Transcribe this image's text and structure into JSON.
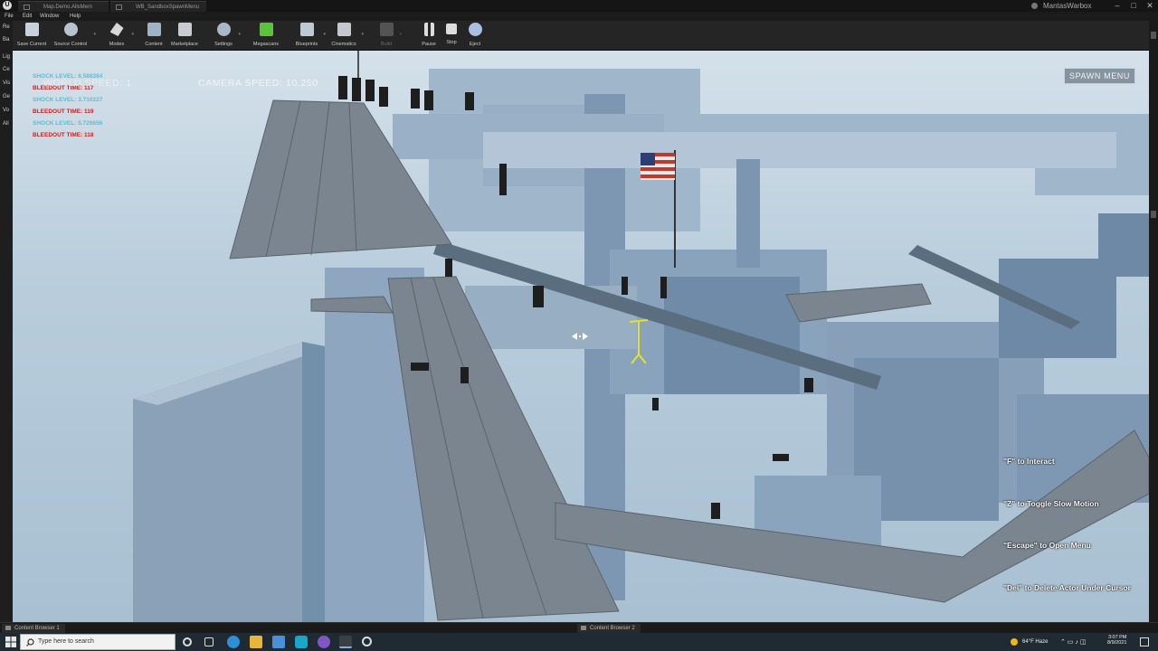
{
  "titlebar": {
    "tabs": [
      "Map.Demo.AllsMem",
      "WB_SandboxSpawnMenu"
    ],
    "user": "MantasWarbox",
    "window_controls": [
      "minimize",
      "maximize",
      "close"
    ]
  },
  "menu": [
    "File",
    "Edit",
    "Window",
    "Help"
  ],
  "toolbar": {
    "buttons": [
      {
        "label": "Save Current",
        "icon": "save-icon"
      },
      {
        "label": "Source Control",
        "icon": "source-control-icon"
      },
      {
        "label": "Modes",
        "icon": "modes-icon"
      },
      {
        "label": "Content",
        "icon": "content-icon"
      },
      {
        "label": "Marketplace",
        "icon": "marketplace-icon"
      },
      {
        "label": "Settings",
        "icon": "settings-icon"
      },
      {
        "label": "Megascans",
        "icon": "megascans-icon"
      },
      {
        "label": "Blueprints",
        "icon": "blueprints-icon"
      },
      {
        "label": "Cinematics",
        "icon": "cinematics-icon"
      },
      {
        "label": "Build",
        "icon": "build-icon"
      },
      {
        "label": "Pause",
        "icon": "pause-icon"
      },
      {
        "label": "Stop",
        "icon": "stop-icon"
      },
      {
        "label": "Eject",
        "icon": "eject-icon"
      }
    ]
  },
  "left_rail": [
    "Re",
    "Ba",
    "Lig",
    "Ce",
    "Vis",
    "Ge",
    "Vo",
    "All"
  ],
  "hud": {
    "debug_lines": [
      {
        "text": "SHOCK LEVEL: 8.588384",
        "kind": "shock"
      },
      {
        "text": "BLEEDOUT TIME: 117",
        "kind": "bleed"
      },
      {
        "text": "SHOCK LEVEL: 3.710227",
        "kind": "shock"
      },
      {
        "text": "BLEEDOUT TIME: 119",
        "kind": "bleed"
      },
      {
        "text": "SHOCK LEVEL: 5.726656",
        "kind": "shock"
      },
      {
        "text": "BLEEDOUT TIME: 118",
        "kind": "bleed"
      }
    ],
    "world_speed": "WORLD SPEED:   1",
    "camera_speed": "CAMERA SPEED:   10.250",
    "spawn_menu": "SPAWN MENU",
    "hints": [
      "\"F\" to Interact",
      "\"Z\" to Toggle Slow Motion",
      "\"Escape\" to Open Menu",
      "\"Del\" to Delete Actor Under Cursor"
    ]
  },
  "content_browsers": [
    "Content Browser 1",
    "Content Browser 2"
  ],
  "taskbar": {
    "search_placeholder": "Type here to search",
    "weather": "64°F  Haze",
    "time": "3:07 PM",
    "date": "8/9/2021"
  },
  "colors": {
    "shock": "#4fc3d8",
    "bleed": "#d21d1d",
    "sky": "#b9cddc",
    "structure": "#8ea6c0"
  }
}
